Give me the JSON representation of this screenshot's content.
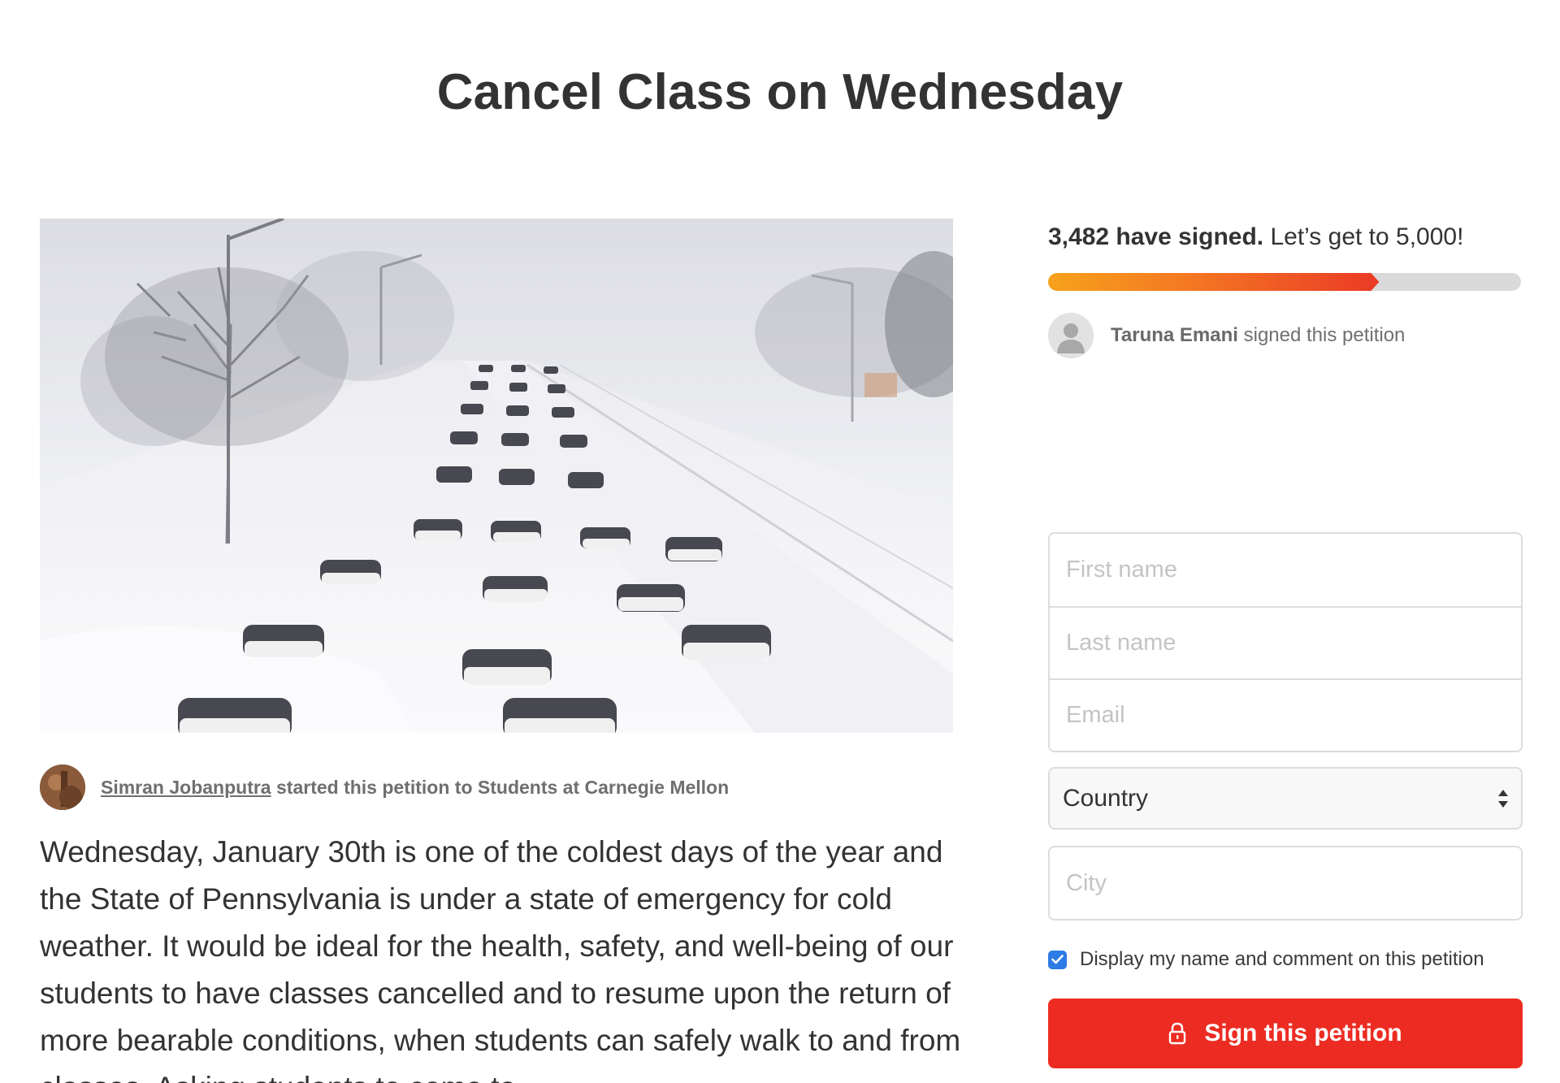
{
  "page": {
    "title": "Cancel Class on Wednesday"
  },
  "colors": {
    "accent": "#ec2c22",
    "progress_start": "#f6a21b",
    "progress_end": "#ea3a25",
    "checkbox": "#2d7be5"
  },
  "hero_image": {
    "subject": "snow-covered cars stranded on highway in blizzard"
  },
  "starter": {
    "avatar_icon": "user-photo-avatar",
    "name": "Simran Jobanputra",
    "suffix": " started this petition to Students at Carnegie Mellon"
  },
  "description": "Wednesday, January 30th is one of the coldest days of the year and the State of Pennsylvania is under a state of emergency for cold weather. It would be ideal for the health, safety, and well-being of our students to have classes cancelled and to resume upon the return of more bearable conditions, when students can safely walk to and from classes. Asking students to come to",
  "progress": {
    "count_label": "3,482 have signed.",
    "goal_label": " Let’s get to 5,000!",
    "signed": 3482,
    "goal": 5000,
    "fraction": 0.7
  },
  "recent_signer": {
    "avatar_icon": "default-user-icon",
    "name": "Taruna Emani",
    "suffix": " signed this petition"
  },
  "form": {
    "first_name_placeholder": "First name",
    "last_name_placeholder": "Last name",
    "email_placeholder": "Email",
    "country_value": "Country",
    "city_placeholder": "City",
    "display_checkbox_label": "Display my name and comment on this petition",
    "display_checked": true,
    "submit_label": "Sign this petition",
    "submit_icon": "lock-icon"
  }
}
